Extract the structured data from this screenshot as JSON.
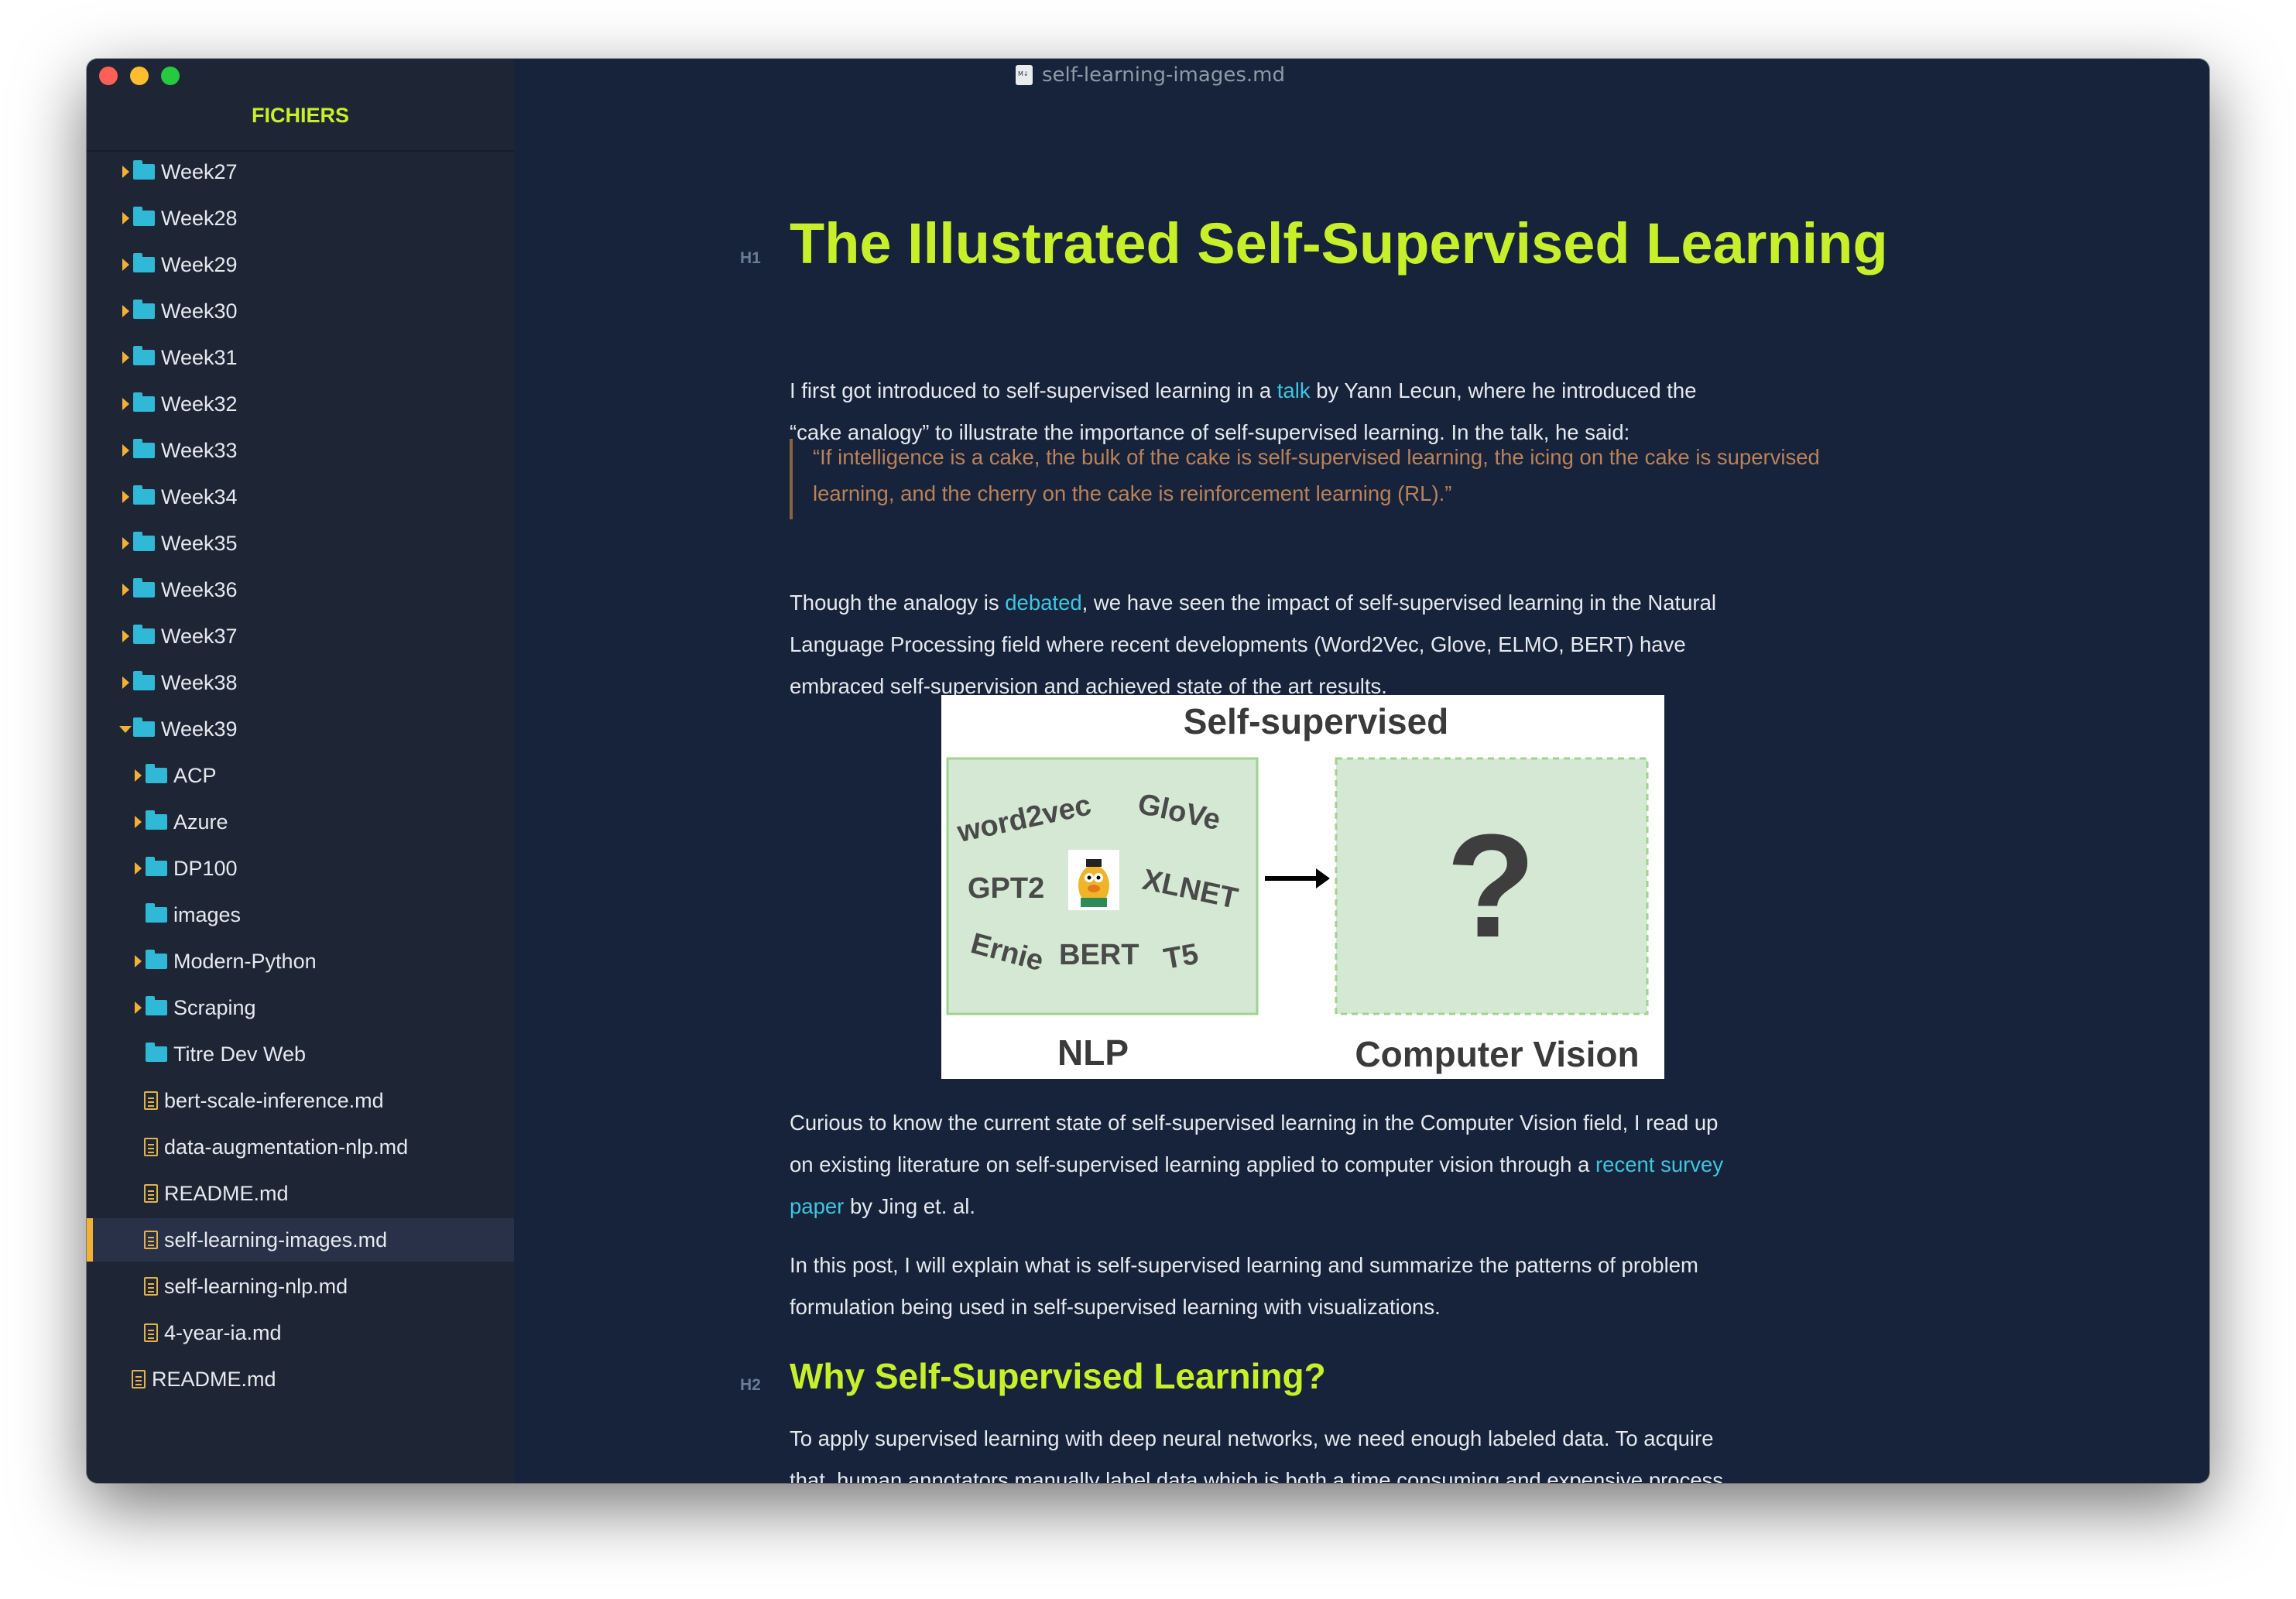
{
  "window": {
    "title": "self-learning-images.md"
  },
  "sidebar": {
    "header": "FICHIERS",
    "items": [
      {
        "label": "Week27",
        "kind": "folder",
        "state": "collapsed",
        "depth": 0
      },
      {
        "label": "Week28",
        "kind": "folder",
        "state": "collapsed",
        "depth": 0
      },
      {
        "label": "Week29",
        "kind": "folder",
        "state": "collapsed",
        "depth": 0
      },
      {
        "label": "Week30",
        "kind": "folder",
        "state": "collapsed",
        "depth": 0
      },
      {
        "label": "Week31",
        "kind": "folder",
        "state": "collapsed",
        "depth": 0
      },
      {
        "label": "Week32",
        "kind": "folder",
        "state": "collapsed",
        "depth": 0
      },
      {
        "label": "Week33",
        "kind": "folder",
        "state": "collapsed",
        "depth": 0
      },
      {
        "label": "Week34",
        "kind": "folder",
        "state": "collapsed",
        "depth": 0
      },
      {
        "label": "Week35",
        "kind": "folder",
        "state": "collapsed",
        "depth": 0
      },
      {
        "label": "Week36",
        "kind": "folder",
        "state": "collapsed",
        "depth": 0
      },
      {
        "label": "Week37",
        "kind": "folder",
        "state": "collapsed",
        "depth": 0
      },
      {
        "label": "Week38",
        "kind": "folder",
        "state": "collapsed",
        "depth": 0
      },
      {
        "label": "Week39",
        "kind": "folder",
        "state": "expanded",
        "depth": 0
      },
      {
        "label": "ACP",
        "kind": "folder",
        "state": "collapsed",
        "depth": 1
      },
      {
        "label": "Azure",
        "kind": "folder",
        "state": "collapsed",
        "depth": 1
      },
      {
        "label": "DP100",
        "kind": "folder",
        "state": "collapsed",
        "depth": 1
      },
      {
        "label": "images",
        "kind": "folder",
        "state": "empty",
        "depth": 1
      },
      {
        "label": "Modern-Python",
        "kind": "folder",
        "state": "collapsed",
        "depth": 1
      },
      {
        "label": "Scraping",
        "kind": "folder",
        "state": "collapsed",
        "depth": 1
      },
      {
        "label": "Titre Dev Web",
        "kind": "folder",
        "state": "empty",
        "depth": 1
      },
      {
        "label": "bert-scale-inference.md",
        "kind": "file",
        "depth": 1
      },
      {
        "label": "data-augmentation-nlp.md",
        "kind": "file",
        "depth": 1
      },
      {
        "label": "README.md",
        "kind": "file",
        "depth": 1
      },
      {
        "label": "self-learning-images.md",
        "kind": "file",
        "depth": 1,
        "selected": true
      },
      {
        "label": "self-learning-nlp.md",
        "kind": "file",
        "depth": 1
      },
      {
        "label": "4-year-ia.md",
        "kind": "file",
        "depth": 1
      },
      {
        "label": "README.md",
        "kind": "file",
        "depth": 0
      }
    ]
  },
  "article": {
    "h1_marker": "H1",
    "title": "The Illustrated Self-Supervised Learning",
    "intro": {
      "line1_a": "I first got introduced to self-supervised learning in a ",
      "line1_link": "talk",
      "line1_b": " by Yann Lecun, where he introduced the",
      "line2": "“cake analogy” to illustrate the importance of self-supervised learning. In the talk, he said:"
    },
    "quote": {
      "line1": "“If intelligence is a cake, the bulk of the cake is self-supervised learning, the icing on the cake is supervised",
      "line2": "learning, and the cherry on the cake is reinforcement learning (RL).”"
    },
    "analogy": {
      "line1_a": "Though the analogy is ",
      "line1_link": "debated",
      "line1_b": ", we have seen the impact of self-supervised learning in the Natural",
      "line2": "Language Processing field where recent developments (Word2Vec, Glove, ELMO, BERT) have",
      "line3": "embraced self-supervision and achieved state of the art results."
    },
    "figure": {
      "title": "Self-supervised",
      "words": [
        "word2vec",
        "GloVe",
        "GPT2",
        "XLNET",
        "Ernie",
        "BERT",
        "T5"
      ],
      "arrow": "→",
      "question": "?",
      "left_label": "NLP",
      "right_label": "Computer Vision"
    },
    "curious": {
      "line1": "Curious to know the current state of self-supervised learning in the Computer Vision field, I read up",
      "line2_a": "on existing literature on self-supervised learning applied to computer vision through a ",
      "line2_link": "recent survey",
      "line3_link": "paper",
      "line3_b": " by Jing et. al."
    },
    "post": {
      "line1": "In this post, I will explain what is self-supervised learning and summarize the patterns of problem",
      "line2": "formulation being used in self-supervised learning with visualizations."
    },
    "h2_marker": "H2",
    "h2": "Why Self-Supervised Learning?",
    "last": {
      "line1": "To apply supervised learning with deep neural networks, we need enough labeled data. To acquire",
      "line2": "that, human annotators manually label data which is both a time consuming and expensive process."
    }
  },
  "colors": {
    "accent": "#c7f02a",
    "link": "#3ec5df",
    "quote": "#b9825a",
    "folder": "#2fb9d6",
    "file": "#e2b34a"
  }
}
